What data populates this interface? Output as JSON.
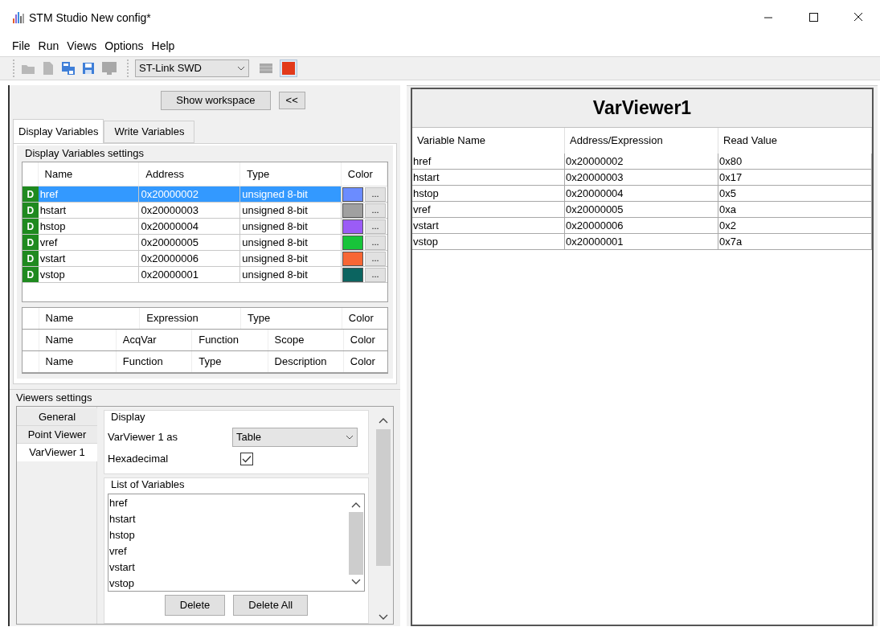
{
  "window": {
    "title": "STM Studio New config*"
  },
  "menu": [
    "File",
    "Run",
    "Views",
    "Options",
    "Help"
  ],
  "toolbar": {
    "interface": "ST-Link SWD"
  },
  "workspace_button": "Show workspace",
  "collapse_button": "<<",
  "tabs": [
    {
      "label": "Display Variables",
      "selected": true
    },
    {
      "label": "Write Variables",
      "selected": false
    }
  ],
  "display_settings": {
    "title": "Display Variables settings",
    "columns": [
      "Name",
      "Address",
      "Type",
      "Color"
    ],
    "rows": [
      {
        "badge": "D",
        "name": "href",
        "address": "0x20000002",
        "type": "unsigned 8-bit",
        "color": "#6b8cff",
        "more": "...",
        "selected": true
      },
      {
        "badge": "D",
        "name": "hstart",
        "address": "0x20000003",
        "type": "unsigned 8-bit",
        "color": "#a0a0a0",
        "more": "...",
        "selected": false
      },
      {
        "badge": "D",
        "name": "hstop",
        "address": "0x20000004",
        "type": "unsigned 8-bit",
        "color": "#9b5cf6",
        "more": "...",
        "selected": false
      },
      {
        "badge": "D",
        "name": "vref",
        "address": "0x20000005",
        "type": "unsigned 8-bit",
        "color": "#18c43a",
        "more": "...",
        "selected": false
      },
      {
        "badge": "D",
        "name": "vstart",
        "address": "0x20000006",
        "type": "unsigned 8-bit",
        "color": "#f76634",
        "more": "...",
        "selected": false
      },
      {
        "badge": "D",
        "name": "vstop",
        "address": "0x20000001",
        "type": "unsigned 8-bit",
        "color": "#0b6460",
        "more": "...",
        "selected": false
      }
    ]
  },
  "expression_table": {
    "columns": [
      "Name",
      "Expression",
      "Type",
      "Color"
    ]
  },
  "acq_table": {
    "columns": [
      "Name",
      "AcqVar",
      "Function",
      "Scope",
      "Color"
    ]
  },
  "function_table": {
    "columns": [
      "Name",
      "Function",
      "Type",
      "Description",
      "Color"
    ]
  },
  "viewers_settings": {
    "title": "Viewers settings",
    "sidebar": [
      {
        "label": "General",
        "selected": false
      },
      {
        "label": "Point Viewer",
        "selected": false
      },
      {
        "label": "VarViewer 1",
        "selected": true
      }
    ],
    "display_title": "Display",
    "mode_label": "VarViewer 1 as",
    "mode": "Table",
    "hex_label": "Hexadecimal",
    "hex_checked": true,
    "list_title": "List of Variables",
    "variables": [
      "href",
      "hstart",
      "hstop",
      "vref",
      "vstart",
      "vstop"
    ],
    "buttons": [
      "Delete",
      "Delete All"
    ]
  },
  "viewer": {
    "title": "VarViewer1",
    "columns": [
      "Variable Name",
      "Address/Expression",
      "Read Value"
    ],
    "rows": [
      [
        "href",
        "0x20000002",
        "0x80"
      ],
      [
        "hstart",
        "0x20000003",
        "0x17"
      ],
      [
        "hstop",
        "0x20000004",
        "0x5"
      ],
      [
        "vref",
        "0x20000005",
        "0xa"
      ],
      [
        "vstart",
        "0x20000006",
        "0x2"
      ],
      [
        "vstop",
        "0x20000001",
        "0x7a"
      ]
    ]
  }
}
